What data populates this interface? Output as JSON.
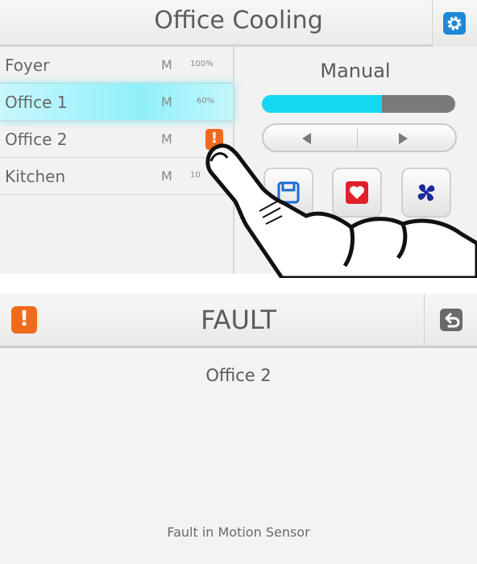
{
  "top_panel": {
    "title": "Office Cooling",
    "settings_icon": "gear-icon",
    "zones": [
      {
        "name": "Foyer",
        "mode": "M",
        "level": "100%",
        "selected": false,
        "fault": false
      },
      {
        "name": "Office 1",
        "mode": "M",
        "level": "60%",
        "selected": true,
        "fault": false
      },
      {
        "name": "Office 2",
        "mode": "M",
        "level": "",
        "selected": false,
        "fault": true
      },
      {
        "name": "Kitchen",
        "mode": "M",
        "level": "10",
        "selected": false,
        "fault": false
      }
    ],
    "control": {
      "mode_label": "Manual",
      "speed_fraction": 0.62,
      "buttons": [
        "save-icon",
        "heart-icon",
        "fan-icon"
      ]
    },
    "colors": {
      "accent_cyan": "#12d9f1",
      "settings_blue": "#1e88d8",
      "fault_orange": "#f06a1e",
      "heart_red": "#e0202a",
      "fan_navy": "#1a2a9a"
    }
  },
  "fault_panel": {
    "badge_symbol": "!",
    "title": "FAULT",
    "zone": "Office 2",
    "message": "Fault in Motion Sensor",
    "back_icon": "back-icon"
  }
}
